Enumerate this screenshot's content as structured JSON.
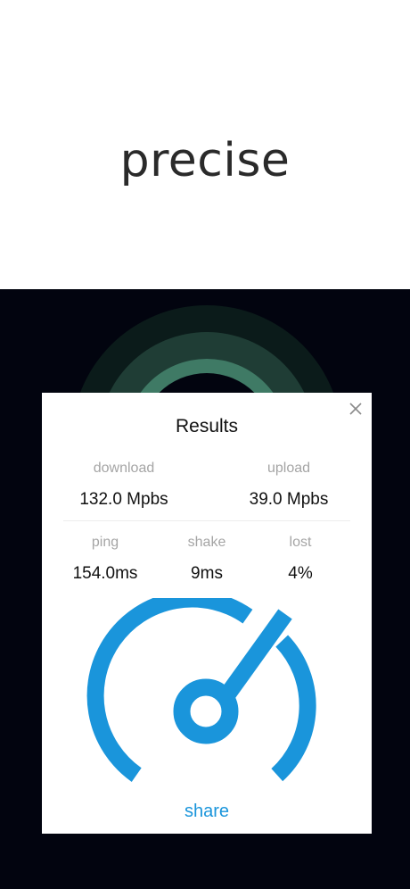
{
  "headline": "precise",
  "results": {
    "title": "Results",
    "download_label": "download",
    "download_value": "132.0 Mpbs",
    "upload_label": "upload",
    "upload_value": "39.0 Mpbs",
    "ping_label": "ping",
    "ping_value": "154.0ms",
    "shake_label": "shake",
    "shake_value": "9ms",
    "lost_label": "lost",
    "lost_value": "4%",
    "share_label": "share"
  },
  "colors": {
    "accent": "#1a95db",
    "dark_bg": "#02040f",
    "ring": "#3f7a65"
  },
  "icons": {
    "close": "close-icon",
    "gauge": "speedometer-icon"
  }
}
